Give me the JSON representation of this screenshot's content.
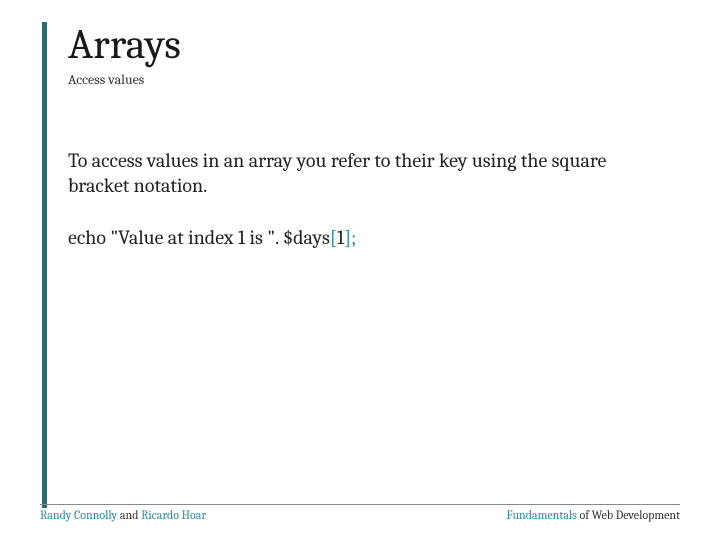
{
  "title": "Arrays",
  "subtitle": "Access values",
  "body": "To access values in an array you refer to their key using the square bracket notation.",
  "code": {
    "prefix": "echo \"Value at index 1 is \". $days",
    "open": "[",
    "index": "1",
    "close": "]",
    "semicolon": ";"
  },
  "footer": {
    "author1": "Randy Connolly",
    "authorSep": " and ",
    "author2": "Ricardo Hoar",
    "bookStrong": "Fundamentals",
    "bookRest": " of Web Development"
  }
}
